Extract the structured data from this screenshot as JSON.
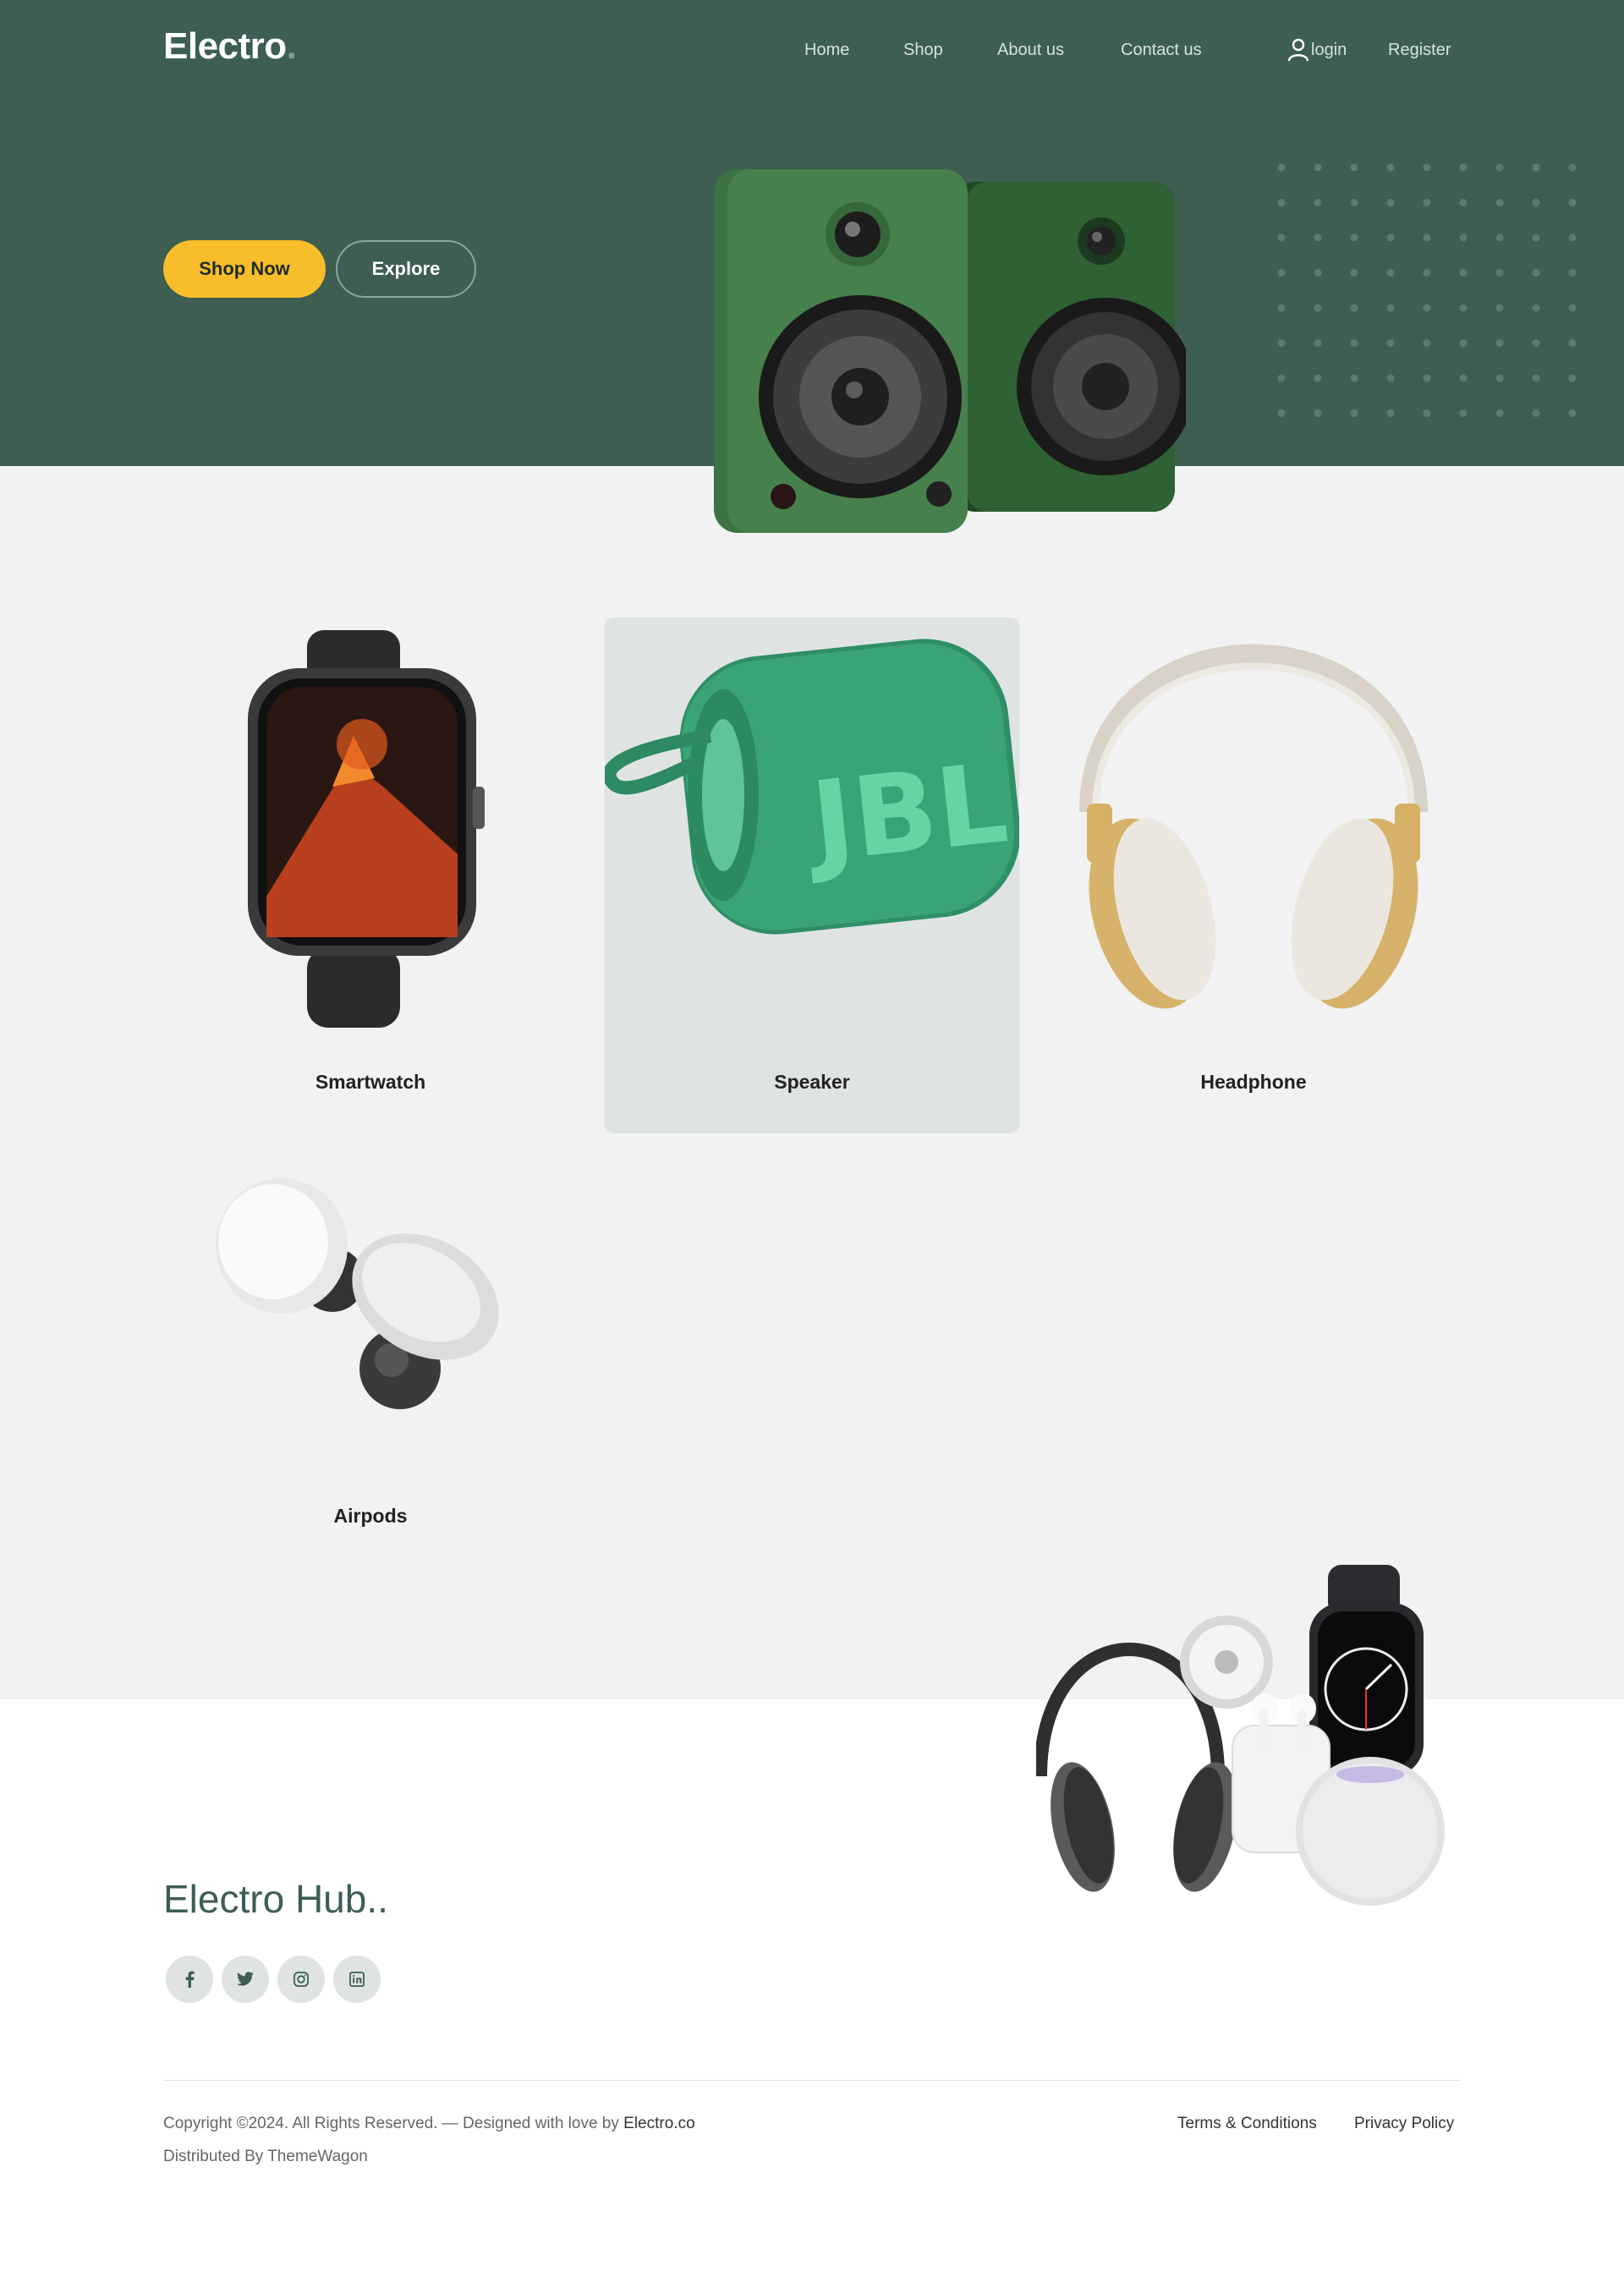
{
  "header": {
    "logo": "Electro",
    "logo_dot": ".",
    "nav": [
      "Home",
      "Shop",
      "About us",
      "Contact us"
    ],
    "login": "login",
    "register": "Register",
    "user_icon": "user-icon"
  },
  "hero": {
    "shop_now": "Shop Now",
    "explore": "Explore",
    "bg_color": "#3d5e51",
    "accent_color": "#f7bd2a"
  },
  "products": [
    {
      "label": "Smartwatch",
      "active": false
    },
    {
      "label": "Speaker",
      "active": true
    },
    {
      "label": "Headphone",
      "active": false
    },
    {
      "label": "Airpods",
      "active": false
    }
  ],
  "footer": {
    "brand": "Electro Hub..",
    "socials": [
      "facebook-icon",
      "twitter-icon",
      "instagram-icon",
      "linkedin-icon"
    ],
    "copyright_text": "Copyright ©2024. All Rights Reserved. — Designed with love by ",
    "copyright_owner": "Electro.co",
    "distributed": "Distributed By ThemeWagon",
    "terms": "Terms & Conditions",
    "privacy": "Privacy Policy"
  }
}
